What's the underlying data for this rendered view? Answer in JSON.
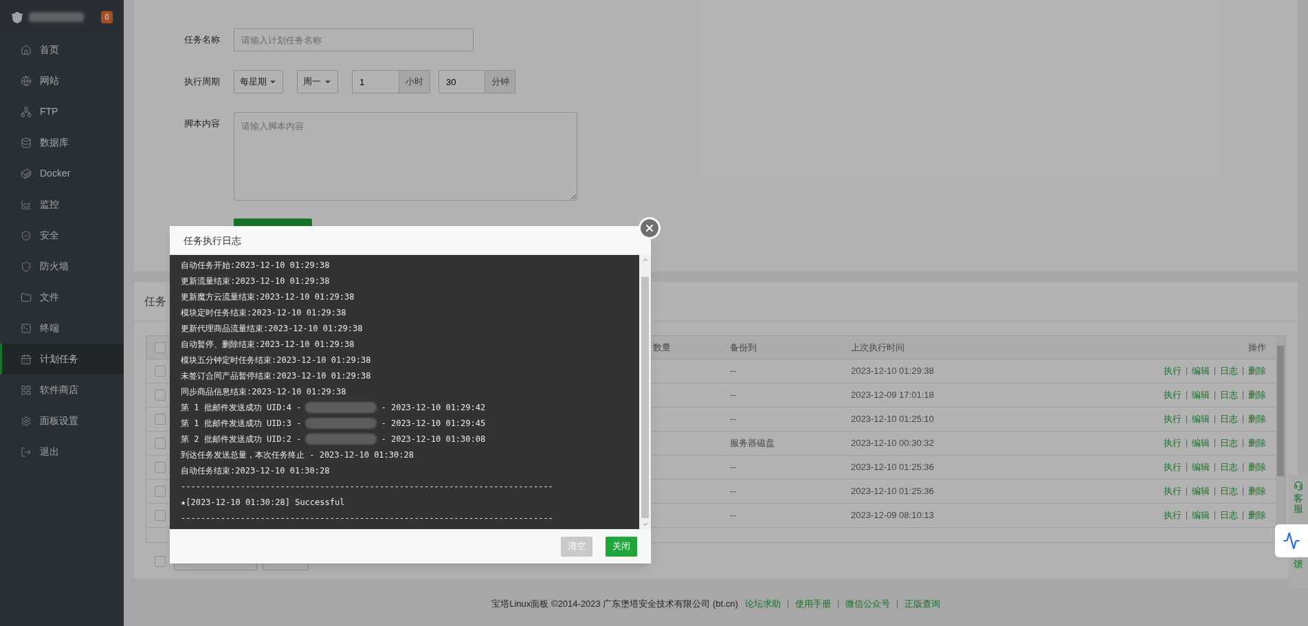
{
  "sidebar": {
    "badge": "0",
    "items": [
      {
        "label": "首页",
        "selected": false
      },
      {
        "label": "网站",
        "selected": false
      },
      {
        "label": "FTP",
        "selected": false
      },
      {
        "label": "数据库",
        "selected": false
      },
      {
        "label": "Docker",
        "selected": false
      },
      {
        "label": "监控",
        "selected": false
      },
      {
        "label": "安全",
        "selected": false
      },
      {
        "label": "防火墙",
        "selected": false
      },
      {
        "label": "文件",
        "selected": false
      },
      {
        "label": "终端",
        "selected": false
      },
      {
        "label": "计划任务",
        "selected": true
      },
      {
        "label": "软件商店",
        "selected": false
      },
      {
        "label": "面板设置",
        "selected": false
      },
      {
        "label": "退出",
        "selected": false
      }
    ]
  },
  "task_form": {
    "fields": [
      {
        "kind": "text",
        "label": "任务名称",
        "placeholder": "请输入计划任务名称"
      },
      {
        "kind": "period",
        "label": "执行周期",
        "period": "每星期",
        "day": "周一",
        "hour": "1",
        "hour_unit": "小时",
        "minute": "30",
        "minute_unit": "分钟"
      },
      {
        "kind": "textarea",
        "label": "脚本内容",
        "placeholder": "请输入脚本内容"
      }
    ]
  },
  "task_list": {
    "title": "任务",
    "header_checked": false,
    "columns": [
      "数量",
      "备份到",
      "上次执行时间",
      "操作"
    ],
    "rows": [
      {
        "checked": false,
        "backup_to": "--",
        "last_run": "2023-12-10 01:29:38",
        "actions": [
          "执行",
          "编辑",
          "日志",
          "删除"
        ]
      },
      {
        "checked": false,
        "backup_to": "--",
        "last_run": "2023-12-09 17:01:18",
        "actions": [
          "执行",
          "编辑",
          "日志",
          "删除"
        ]
      },
      {
        "checked": false,
        "backup_to": "--",
        "last_run": "2023-12-10 01:25:10",
        "actions": [
          "执行",
          "编辑",
          "日志",
          "删除"
        ]
      },
      {
        "checked": false,
        "backup_to": "服务器磁盘",
        "last_run": "2023-12-10 00:30:32",
        "actions": [
          "执行",
          "编辑",
          "日志",
          "删除"
        ]
      },
      {
        "checked": false,
        "backup_to": "--",
        "last_run": "2023-12-10 01:25:36",
        "actions": [
          "执行",
          "编辑",
          "日志",
          "删除"
        ]
      },
      {
        "checked": false,
        "backup_to": "--",
        "last_run": "2023-12-10 01:25:36",
        "actions": [
          "执行",
          "编辑",
          "日志",
          "删除"
        ]
      },
      {
        "checked": false,
        "backup_to": "--",
        "last_run": "2023-12-09 08:10:13",
        "actions": [
          "执行",
          "编辑",
          "日志",
          "删除"
        ]
      }
    ],
    "footer_checked": false
  },
  "log_dialog": {
    "title": "任务执行日志",
    "lines": [
      {
        "kind": "text",
        "text": "自动任务开始:2023-12-10 01:29:38"
      },
      {
        "kind": "text",
        "text": "更新流量结束:2023-12-10 01:29:38"
      },
      {
        "kind": "text",
        "text": "更新魔方云流量结束:2023-12-10 01:29:38"
      },
      {
        "kind": "text",
        "text": "模块定时任务结束:2023-12-10 01:29:38"
      },
      {
        "kind": "text",
        "text": "更新代理商品流量结束:2023-12-10 01:29:38"
      },
      {
        "kind": "text",
        "text": "自动暂停、删除结束:2023-12-10 01:29:38"
      },
      {
        "kind": "text",
        "text": "模块五分钟定时任务结束:2023-12-10 01:29:38"
      },
      {
        "kind": "text",
        "text": "未签订合同产品暂停结束:2023-12-10 01:29:38"
      },
      {
        "kind": "text",
        "text": "同步商品信息结束:2023-12-10 01:29:38"
      },
      {
        "kind": "redacted",
        "before": "第 1 批邮件发送成功 UID:4 -",
        "after": "- 2023-12-10 01:29:42"
      },
      {
        "kind": "redacted",
        "before": "第 1 批邮件发送成功 UID:3 -",
        "after": "- 2023-12-10 01:29:45"
      },
      {
        "kind": "redacted",
        "before": "第 2 批邮件发送成功 UID:2 -",
        "after": "- 2023-12-10 01:30:08"
      },
      {
        "kind": "text",
        "text": "到达任务发送总量，本次任务终止 - 2023-12-10 01:30:28"
      },
      {
        "kind": "text",
        "text": "自动任务结束:2023-12-10 01:30:28"
      },
      {
        "kind": "rule",
        "text": "---------------------------------------------------------------------------"
      },
      {
        "kind": "text",
        "text": "★[2023-12-10 01:30:28] Successful"
      },
      {
        "kind": "rule",
        "text": "---------------------------------------------------------------------------"
      }
    ],
    "buttons": [
      {
        "label": "清空",
        "disabled": true
      },
      {
        "label": "关闭",
        "disabled": false
      }
    ]
  },
  "footer": {
    "text": "宝塔Linux面板 ©2014-2023 广东堡塔安全技术有限公司 (bt.cn)",
    "links": [
      "论坛求助",
      "使用手册",
      "微信公众号",
      "正版查询"
    ]
  },
  "side_widget": {
    "service": "客服",
    "feedback": "馈"
  }
}
